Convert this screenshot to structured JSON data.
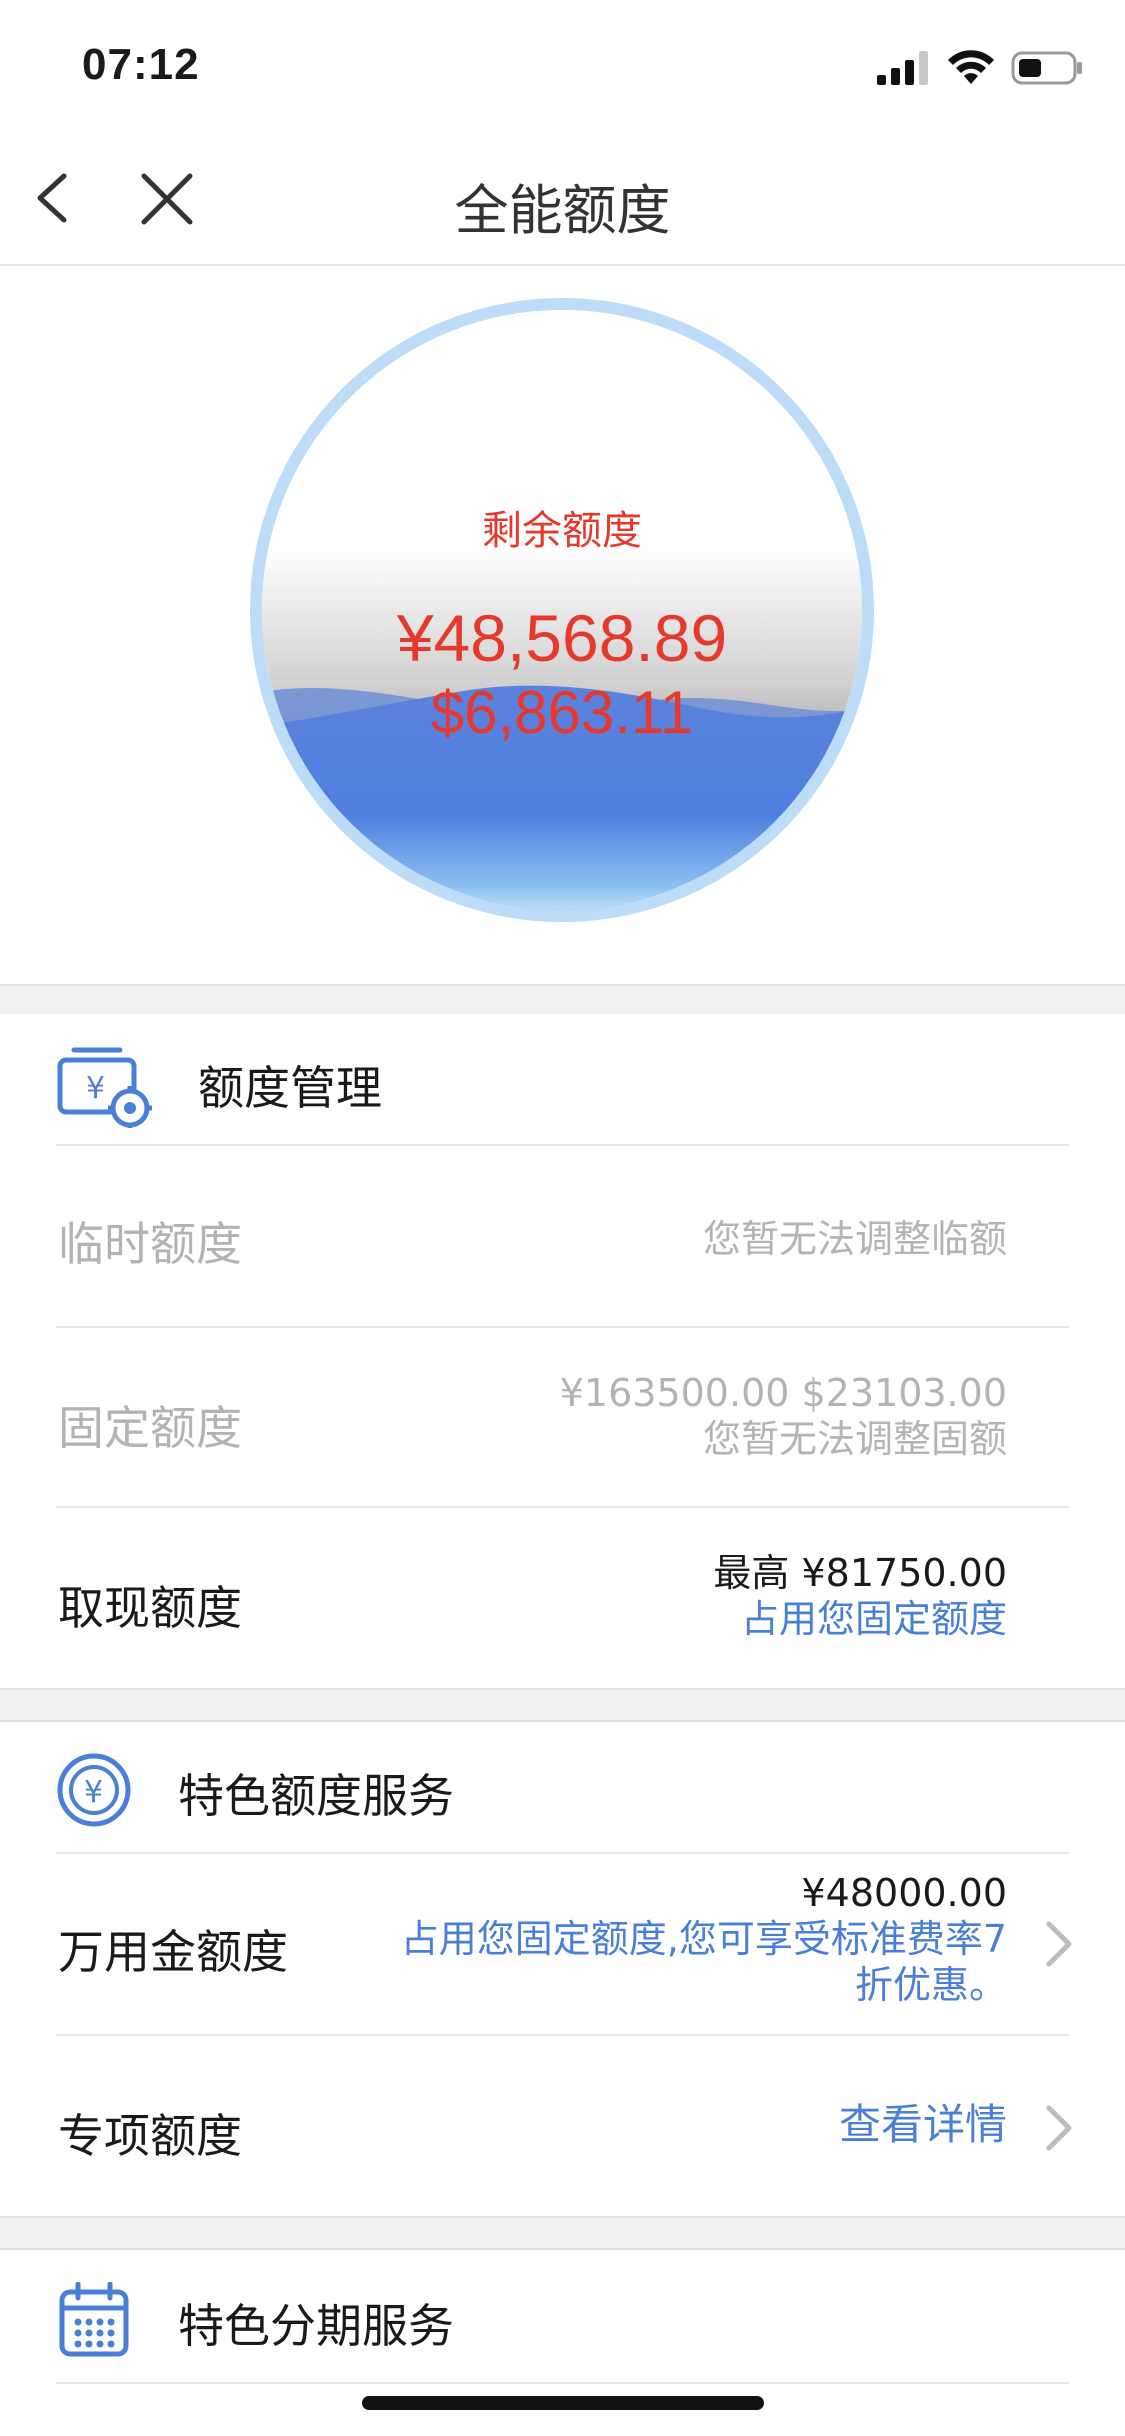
{
  "status_bar": {
    "time": "07:12"
  },
  "nav": {
    "title": "全能额度"
  },
  "quota": {
    "label": "剩余额度",
    "cny_amount": "¥48,568.89",
    "usd_amount": "$6,863.11"
  },
  "limit_management": {
    "title": "额度管理",
    "temporary": {
      "label": "临时额度",
      "value": "您暂无法调整临额"
    },
    "fixed": {
      "label": "固定额度",
      "amount": "¥163500.00 $23103.00",
      "note": "您暂无法调整固额"
    },
    "cash": {
      "label": "取现额度",
      "amount": "最高 ¥81750.00",
      "note": "占用您固定额度"
    }
  },
  "special_limit_service": {
    "title": "特色额度服务",
    "wanyongjin": {
      "label": "万用金额度",
      "amount": "¥48000.00",
      "note_line1": "占用您固定额度,您可享受标准费率7",
      "note_line2": "折优惠。"
    },
    "special": {
      "label": "专项额度",
      "link": "查看详情"
    }
  },
  "installment_service": {
    "title": "特色分期服务"
  },
  "colors": {
    "accent_red": "#e6392b",
    "link_blue": "#4a7fd8",
    "wave_blue": "#4f7fe0",
    "ring_blue": "#bcdcf8"
  }
}
